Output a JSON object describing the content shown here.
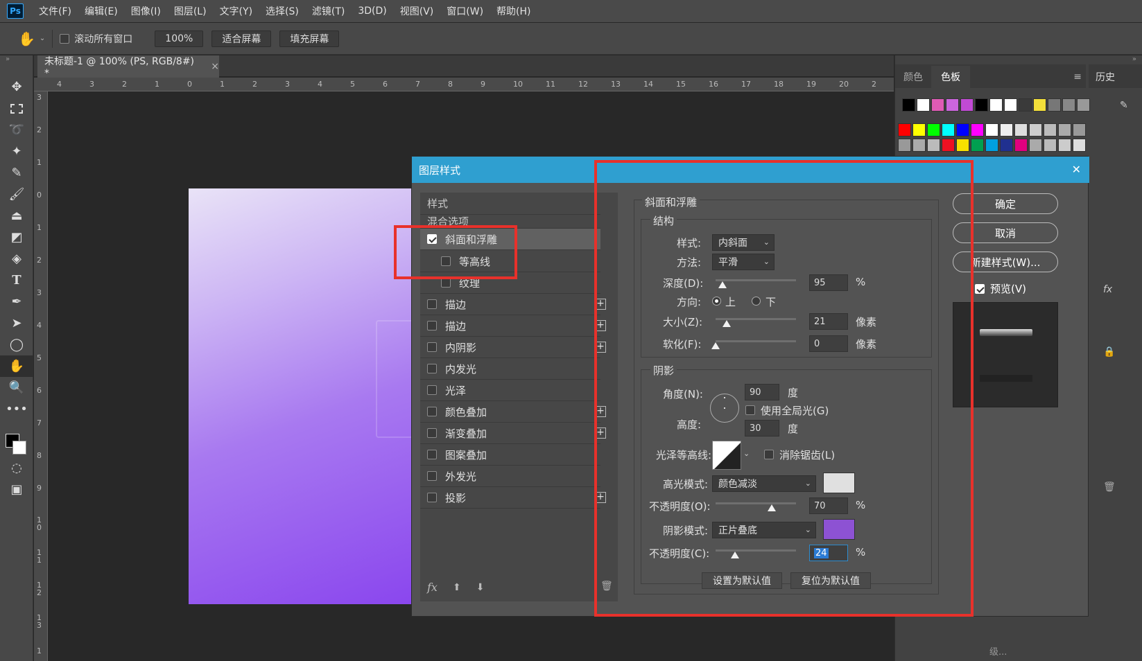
{
  "app": {
    "logo": "Ps"
  },
  "menu": [
    "文件(F)",
    "编辑(E)",
    "图像(I)",
    "图层(L)",
    "文字(Y)",
    "选择(S)",
    "滤镜(T)",
    "3D(D)",
    "视图(V)",
    "窗口(W)",
    "帮助(H)"
  ],
  "options": {
    "scroll_all": "滚动所有窗口",
    "zoom": "100%",
    "fit_screen": "适合屏幕",
    "fill_screen": "填充屏幕"
  },
  "document": {
    "tab_title": "未标题-1 @ 100% (PS, RGB/8#) *",
    "close": "×"
  },
  "ruler_h": [
    "4",
    "3",
    "2",
    "1",
    "0",
    "1",
    "2",
    "3",
    "4",
    "5",
    "6",
    "7",
    "8",
    "9",
    "10",
    "11",
    "12",
    "13",
    "14",
    "15",
    "16",
    "17",
    "18",
    "19",
    "20",
    "2"
  ],
  "ruler_v": [
    "3",
    "2",
    "1",
    "0",
    "1",
    "2",
    "3",
    "4",
    "5",
    "6",
    "7",
    "8",
    "9",
    "1 0",
    "1 1",
    "1 2",
    "1 3",
    "1"
  ],
  "right_panel": {
    "tab_color": "颜色",
    "tab_swatches": "色板",
    "tab_history": "历史",
    "bottom_text": "级..."
  },
  "swatch_colors": {
    "row1": [
      "#000000",
      "#ffffff",
      "#e05bb5",
      "#cc66dd",
      "#c14ad4",
      "#000000",
      "#ffffff",
      "#ffffff",
      "#3a3a3a",
      "#f4e03a",
      "#777777",
      "#888888",
      "#999999"
    ],
    "row2": [
      "#ff0000",
      "#ffff00",
      "#00ff00",
      "#00ffff",
      "#0000ff",
      "#ff00ff",
      "#ffffff",
      "#eeeeee",
      "#dddddd",
      "#cccccc",
      "#bbbbbb",
      "#aaaaaa",
      "#999999"
    ],
    "row3": [
      "#999999",
      "#aaaaaa",
      "#bbbbbb",
      "#ee1122",
      "#f8e000",
      "#00a050",
      "#00a0e0",
      "#203090",
      "#e0007f",
      "#aaaaaa",
      "#bbbbbb",
      "#cccccc",
      "#dddddd"
    ]
  },
  "dialog": {
    "title": "图层样式",
    "close": "✕",
    "styles_header": "样式",
    "blend_options": "混合选项",
    "list": [
      {
        "label": "斜面和浮雕",
        "checked": true,
        "plus": false
      },
      {
        "label": "等高线",
        "checked": false,
        "plus": false
      },
      {
        "label": "纹理",
        "checked": false,
        "plus": false
      },
      {
        "label": "描边",
        "checked": false,
        "plus": true
      },
      {
        "label": "描边",
        "checked": false,
        "plus": true
      },
      {
        "label": "内阴影",
        "checked": false,
        "plus": true
      },
      {
        "label": "内发光",
        "checked": false,
        "plus": false
      },
      {
        "label": "光泽",
        "checked": false,
        "plus": false
      },
      {
        "label": "颜色叠加",
        "checked": false,
        "plus": true
      },
      {
        "label": "渐变叠加",
        "checked": false,
        "plus": true
      },
      {
        "label": "图案叠加",
        "checked": false,
        "plus": false
      },
      {
        "label": "外发光",
        "checked": false,
        "plus": false
      },
      {
        "label": "投影",
        "checked": false,
        "plus": true
      }
    ],
    "footer_fx": "fx",
    "bevel": {
      "section_title": "斜面和浮雕",
      "structure": "结构",
      "style_label": "样式:",
      "style_value": "内斜面",
      "technique_label": "方法:",
      "technique_value": "平滑",
      "depth_label": "深度(D):",
      "depth_value": "95",
      "depth_unit": "%",
      "depth_level": 0.1,
      "direction_label": "方向:",
      "dir_up": "上",
      "dir_down": "下",
      "size_label": "大小(Z):",
      "size_value": "21",
      "size_unit": "像素",
      "size_level": 0.14,
      "soften_label": "软化(F):",
      "soften_value": "0",
      "soften_unit": "像素",
      "soften_level": 0.0,
      "shading": "阴影",
      "angle_label": "角度(N):",
      "angle_value": "90",
      "angle_unit": "度",
      "global_light": "使用全局光(G)",
      "altitude_label": "高度:",
      "altitude_value": "30",
      "altitude_unit": "度",
      "gloss_label": "光泽等高线:",
      "anti_alias": "消除锯齿(L)",
      "highlight_label": "高光模式:",
      "highlight_value": "颜色减淡",
      "highlight_color": "#e0e0e0",
      "hl_opacity_label": "不透明度(O):",
      "hl_opacity_value": "70",
      "hl_opacity_unit": "%",
      "hl_opacity_level": 0.7,
      "shadow_label": "阴影模式:",
      "shadow_value": "正片叠底",
      "shadow_color": "#8d52d3",
      "sh_opacity_label": "不透明度(C):",
      "sh_opacity_value": "24",
      "sh_opacity_unit": "%",
      "sh_opacity_level": 0.24,
      "make_default": "设置为默认值",
      "reset_default": "复位为默认值"
    },
    "buttons": {
      "ok": "确定",
      "cancel": "取消",
      "new_style": "新建样式(W)...",
      "preview": "预览(V)"
    }
  }
}
